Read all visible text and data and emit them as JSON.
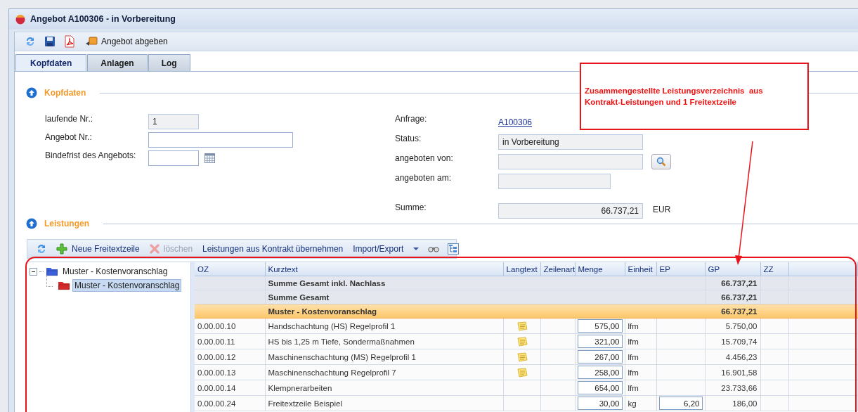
{
  "window": {
    "title": "Angebot A100306 - in Vorbereitung"
  },
  "toolbar": {
    "items": [
      {
        "kind": "refresh"
      },
      {
        "kind": "save"
      },
      {
        "kind": "pdf"
      },
      {
        "kind": "action",
        "label": "Angebot abgeben"
      }
    ]
  },
  "tabs": [
    {
      "label": "Kopfdaten",
      "selected": true
    },
    {
      "label": "Anlagen",
      "selected": false
    },
    {
      "label": "Log",
      "selected": false
    }
  ],
  "kopfdaten": {
    "title": "Kopfdaten",
    "left_fields": [
      {
        "kind": "text",
        "label": "laufende Nr.:",
        "value": "1",
        "readonly": true
      },
      {
        "kind": "text",
        "label": "Angebot Nr.:",
        "readonly": false
      },
      {
        "kind": "date",
        "label": "Bindefrist des Angebots:",
        "readonly": false
      }
    ],
    "right_fields": [
      {
        "kind": "link",
        "label": "Anfrage:",
        "value": "A100306"
      },
      {
        "kind": "field",
        "label": "Status:",
        "value": "in Vorbereitung",
        "readonly": true,
        "lookup": false
      },
      {
        "kind": "field",
        "label": "angeboten von:",
        "readonly": true,
        "lookup": true
      },
      {
        "kind": "field",
        "label": "angeboten am:",
        "readonly": true,
        "lookup": false
      },
      {
        "kind": "amount",
        "label": "Summe:",
        "value": "66.737,21",
        "unit": "EUR",
        "readonly": true
      }
    ]
  },
  "leistungen": {
    "title": "Leistungen",
    "toolbar": [
      {
        "kind": "refresh"
      },
      {
        "kind": "add",
        "label": "Neue Freitextzeile",
        "disabled": false
      },
      {
        "kind": "delete",
        "label": "löschen",
        "disabled": true
      },
      {
        "kind": "text",
        "label": "Leistungen aus Kontrakt übernehmen",
        "disabled": false
      },
      {
        "kind": "menu",
        "label": "Import/Export",
        "disabled": false
      },
      {
        "kind": "binoculars"
      },
      {
        "kind": "tree"
      }
    ],
    "tree": [
      {
        "label": "Muster - Kostenvoranschlag",
        "expanded": true,
        "selected": false,
        "color": "#3a5fd8",
        "children": [
          {
            "label": "Muster - Kostenvoranschlag",
            "selected": true,
            "color": "#d42a2a"
          }
        ]
      }
    ],
    "table": {
      "columns": [
        "OZ",
        "Kurztext",
        "Langtext",
        "Zeilenart",
        "Menge",
        "Einheit",
        "EP",
        "GP",
        "ZZ"
      ],
      "rows": [
        {
          "kind": "total",
          "kurztext": "Summe Gesamt inkl. Nachlass",
          "gp": "66.737,21"
        },
        {
          "kind": "total",
          "kurztext": "Summe Gesamt",
          "gp": "66.737,21"
        },
        {
          "kind": "group",
          "kurztext": "Muster - Kostenvoranschlag",
          "gp": "66.737,21"
        },
        {
          "kind": "item",
          "oz": "0.00.00.10",
          "kurztext": "Handschachtung (HS) Regelprofil 1",
          "langtext": true,
          "menge": "575,00",
          "einheit": "lfm",
          "gp": "5.750,00"
        },
        {
          "kind": "item",
          "oz": "0.00.00.11",
          "kurztext": "HS bis 1,25 m Tiefe, Sondermaßnahmen",
          "langtext": true,
          "menge": "321,00",
          "einheit": "lfm",
          "gp": "15.709,74"
        },
        {
          "kind": "item",
          "oz": "0.00.00.12",
          "kurztext": "Maschinenschachtung (MS) Regelprofil 1",
          "langtext": true,
          "menge": "267,00",
          "einheit": "lfm",
          "gp": "4.456,23"
        },
        {
          "kind": "item",
          "oz": "0.00.00.13",
          "kurztext": "Maschinenschachtung Regelprofil 7",
          "langtext": true,
          "menge": "258,00",
          "einheit": "lfm",
          "gp": "16.901,58"
        },
        {
          "kind": "item",
          "oz": "0.00.00.14",
          "kurztext": "Klempnerarbeiten",
          "langtext": false,
          "menge": "654,00",
          "einheit": "lfm",
          "gp": "23.733,66"
        },
        {
          "kind": "item",
          "oz": "0.00.00.24",
          "kurztext": "Freitextzeile Beispiel",
          "langtext": false,
          "menge": "30,00",
          "einheit": "kg",
          "ep": "6,20",
          "gp": "186,00"
        }
      ]
    }
  },
  "callout": {
    "lines": [
      "Zusammengestellte Leistungsverzeichnis  aus",
      "Kontrakt-Leistungen und 1 Freitextzeile"
    ]
  }
}
